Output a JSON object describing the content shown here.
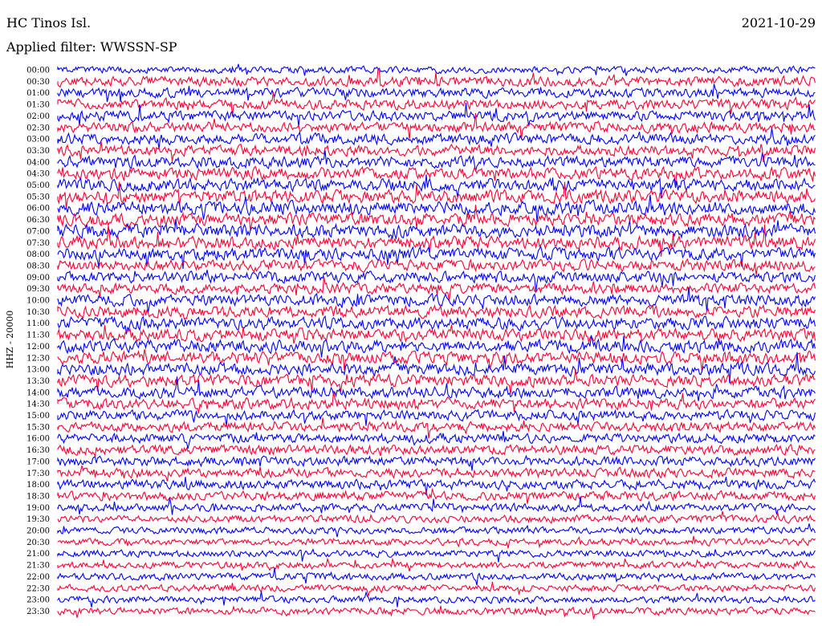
{
  "header": {
    "station": "HC Tinos Isl.",
    "date": "2021-10-29",
    "filter_text": "Applied filter: WWSSN-SP"
  },
  "channel_label": "HHZ - 20000",
  "chart_data": {
    "type": "line",
    "title": "HC Tinos Isl.",
    "subtitle": "Applied filter: WWSSN-SP",
    "date": "2021-10-29",
    "ylabel": "HHZ - 20000",
    "xlabel": "",
    "row_labels": [
      "00:00",
      "00:30",
      "01:00",
      "01:30",
      "02:00",
      "02:30",
      "03:00",
      "03:30",
      "04:00",
      "04:30",
      "05:00",
      "05:30",
      "06:00",
      "06:30",
      "07:00",
      "07:30",
      "08:00",
      "08:30",
      "09:00",
      "09:30",
      "10:00",
      "10:30",
      "11:00",
      "11:30",
      "12:00",
      "12:30",
      "13:00",
      "13:30",
      "14:00",
      "14:30",
      "15:00",
      "15:30",
      "16:00",
      "16:30",
      "17:00",
      "17:30",
      "18:00",
      "18:30",
      "19:00",
      "19:30",
      "20:00",
      "20:30",
      "21:00",
      "21:30",
      "22:00",
      "22:30",
      "23:00",
      "23:30"
    ],
    "trace_colors": [
      "#0000ff",
      "#ff0033"
    ],
    "relative_noise_amplitude": [
      0.6,
      0.9,
      0.85,
      0.9,
      0.9,
      0.9,
      0.95,
      0.95,
      1.0,
      1.05,
      1.1,
      1.15,
      1.2,
      1.15,
      1.2,
      1.15,
      1.1,
      1.0,
      0.95,
      0.9,
      1.0,
      1.05,
      1.1,
      1.1,
      1.1,
      1.1,
      1.1,
      1.05,
      1.0,
      0.95,
      0.9,
      0.85,
      0.85,
      0.85,
      0.85,
      0.85,
      0.85,
      0.8,
      0.7,
      0.65,
      0.6,
      0.6,
      0.6,
      0.6,
      0.6,
      0.6,
      0.6,
      0.65
    ],
    "grid": false,
    "legend": "none"
  }
}
